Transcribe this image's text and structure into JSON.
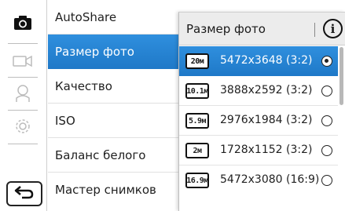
{
  "modes": [
    {
      "name": "camera-icon"
    },
    {
      "name": "video-icon"
    },
    {
      "name": "person-icon"
    },
    {
      "name": "gear-icon"
    }
  ],
  "back": {
    "icon": "back-arrow-icon",
    "glyph": "⮌"
  },
  "menu": {
    "items": [
      {
        "label": "AutoShare"
      },
      {
        "label": "Размер фото",
        "active": true
      },
      {
        "label": "Качество"
      },
      {
        "label": "ISO"
      },
      {
        "label": "Баланс белого"
      },
      {
        "label": "Мастер снимков"
      }
    ]
  },
  "panel": {
    "title": "Размер фото",
    "info_glyph": "i",
    "options": [
      {
        "icon_text": "20м",
        "label": "5472x3648 (3:2)",
        "selected": true
      },
      {
        "icon_text": "10.1м",
        "label": "3888x2592 (3:2)",
        "selected": false
      },
      {
        "icon_text": "5.9м",
        "label": "2976x1984 (3:2)",
        "selected": false
      },
      {
        "icon_text": "2м",
        "label": "1728x1152 (3:2)",
        "selected": false
      },
      {
        "icon_text": "16.9м",
        "label": "5472x3080 (16:9)",
        "selected": false
      }
    ]
  },
  "colors": {
    "accent": "#1f79c8",
    "panel_header": "#ececec"
  }
}
